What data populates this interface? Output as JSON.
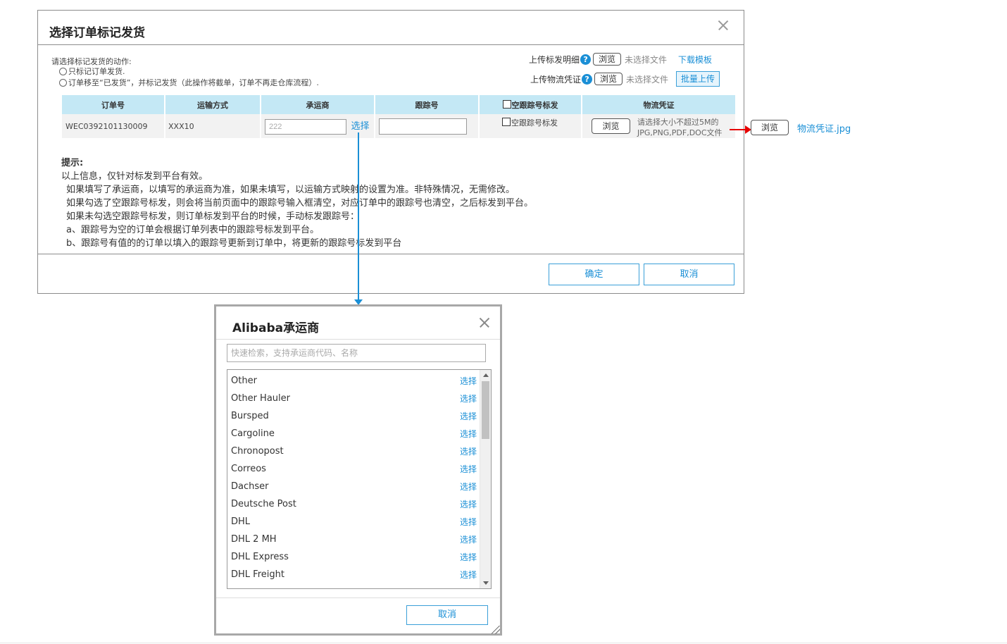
{
  "dialog": {
    "title": "选择订单标记发货",
    "action_label": "请选择标记发货的动作:",
    "radio_options": [
      "只标记订单发货.",
      "订单移至“已发货”，并标记发货（此操作将截单，订单不再走仓库流程）."
    ],
    "upload_detail_label": "上传标发明细",
    "upload_proof_label": "上传物流凭证",
    "help_glyph": "?",
    "browse_label": "浏览",
    "no_file_text": "未选择文件",
    "download_template": "下载模板",
    "batch_upload": "批量上传",
    "table": {
      "headers": [
        "订单号",
        "运输方式",
        "承运商",
        "跟踪号",
        "空跟踪号标发",
        "物流凭证"
      ],
      "row": {
        "order_no": "WEC0392101130009",
        "shipping_method": "XXX10",
        "carrier_value": "222",
        "pick_label": "选择",
        "tracking_no": "",
        "empty_tracking_label": "空跟踪号标发",
        "proof_browse": "浏览",
        "proof_hint_line1": "请选择大小不超过5M的",
        "proof_hint_line2": "JPG,PNG,PDF,DOC文件"
      }
    },
    "tips": {
      "title": "提示:",
      "lines": [
        "以上信息，仅针对标发到平台有效。",
        "如果填写了承运商，以填写的承运商为准，如果未填写，以运输方式映射的设置为准。非特殊情况，无需修改。",
        "如果勾选了空跟踪号标发，则会将当前页面中的跟踪号输入框清空，对应订单中的跟踪号也清空，之后标发到平台。",
        "如果未勾选空跟踪号标发，则订单标发到平台的时候，手动标发跟踪号：",
        "a、跟踪号为空的订单会根据订单列表中的跟踪号标发到平台。",
        "b、跟踪号有值的的订单以填入的跟踪号更新到订单中，将更新的跟踪号标发到平台"
      ]
    },
    "ok_label": "确定",
    "cancel_label": "取消"
  },
  "callout": {
    "browse_label": "浏览",
    "file_name": "物流凭证.jpg",
    "arrow_color": "#e60000",
    "connector_color": "#1a8fd6"
  },
  "peek_glyph": "选",
  "carrier_popup": {
    "title": "Alibaba承运商",
    "search_placeholder": "快速检索，支持承运商代码、名称",
    "pick_label": "选择",
    "carriers": [
      "Other",
      "Other Hauler",
      "Bursped",
      "Cargoline",
      "Chronopost",
      "Correos",
      "Dachser",
      "Deutsche Post",
      "DHL",
      "DHL 2 MH",
      "DHL Express",
      "DHL Freight"
    ],
    "cancel_label": "取消"
  },
  "colors": {
    "accent": "#1a8fd6",
    "table_header": "#c4e8f5",
    "row_bg": "#f2f2f2"
  }
}
